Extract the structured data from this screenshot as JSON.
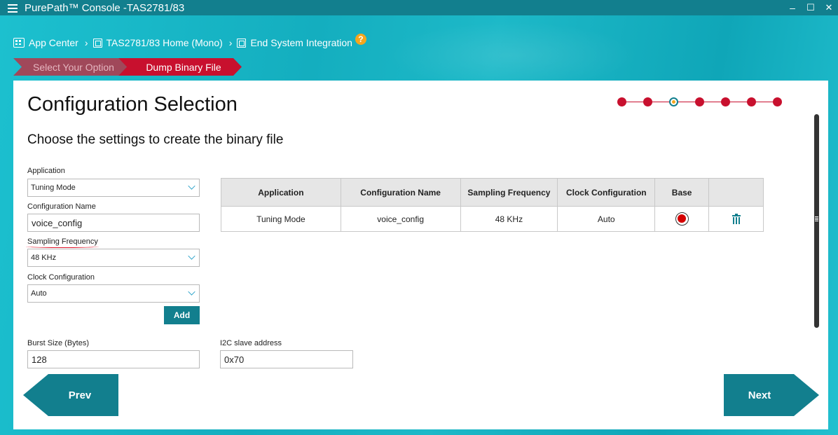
{
  "window": {
    "title": "PurePath™ Console -TAS2781/83",
    "minimize_glyph": "–",
    "maximize_glyph": "☐",
    "close_glyph": "✕"
  },
  "breadcrumb": {
    "items": [
      {
        "label": "App Center",
        "icon": "app-grid-icon"
      },
      {
        "label": "TAS2781/83 Home (Mono)",
        "icon": "chip-icon"
      },
      {
        "label": "End System Integration",
        "icon": "chip-icon"
      }
    ],
    "separator": "›",
    "help": "?"
  },
  "steps": [
    {
      "label": "Select Your Option",
      "state": "done"
    },
    {
      "label": "Dump Binary File",
      "state": "active"
    }
  ],
  "page": {
    "title": "Configuration Selection",
    "subtitle": "Choose the settings to create the binary file",
    "progress": {
      "total": 7,
      "current": 3
    }
  },
  "form": {
    "application": {
      "label": "Application",
      "value": "Tuning Mode"
    },
    "configuration_name": {
      "label": "Configuration Name",
      "value": "voice_config"
    },
    "sampling_frequency": {
      "label": "Sampling Frequency",
      "value": "48 KHz"
    },
    "clock_configuration": {
      "label": "Clock Configuration",
      "value": "Auto"
    },
    "add_label": "Add",
    "burst_size": {
      "label": "Burst Size (Bytes)",
      "value": "128"
    },
    "i2c_address": {
      "label": "I2C slave address",
      "value": "0x70"
    }
  },
  "table": {
    "headers": [
      "Application",
      "Configuration Name",
      "Sampling Frequency",
      "Clock Configuration",
      "Base",
      ""
    ],
    "rows": [
      {
        "application": "Tuning Mode",
        "configuration_name": "voice_config",
        "sampling_frequency": "48 KHz",
        "clock_configuration": "Auto",
        "base": true
      }
    ]
  },
  "nav": {
    "prev_label": "Prev",
    "next_label": "Next"
  },
  "colors": {
    "teal": "#127f8e",
    "red": "#c8102e",
    "accent": "#f4a61d"
  }
}
